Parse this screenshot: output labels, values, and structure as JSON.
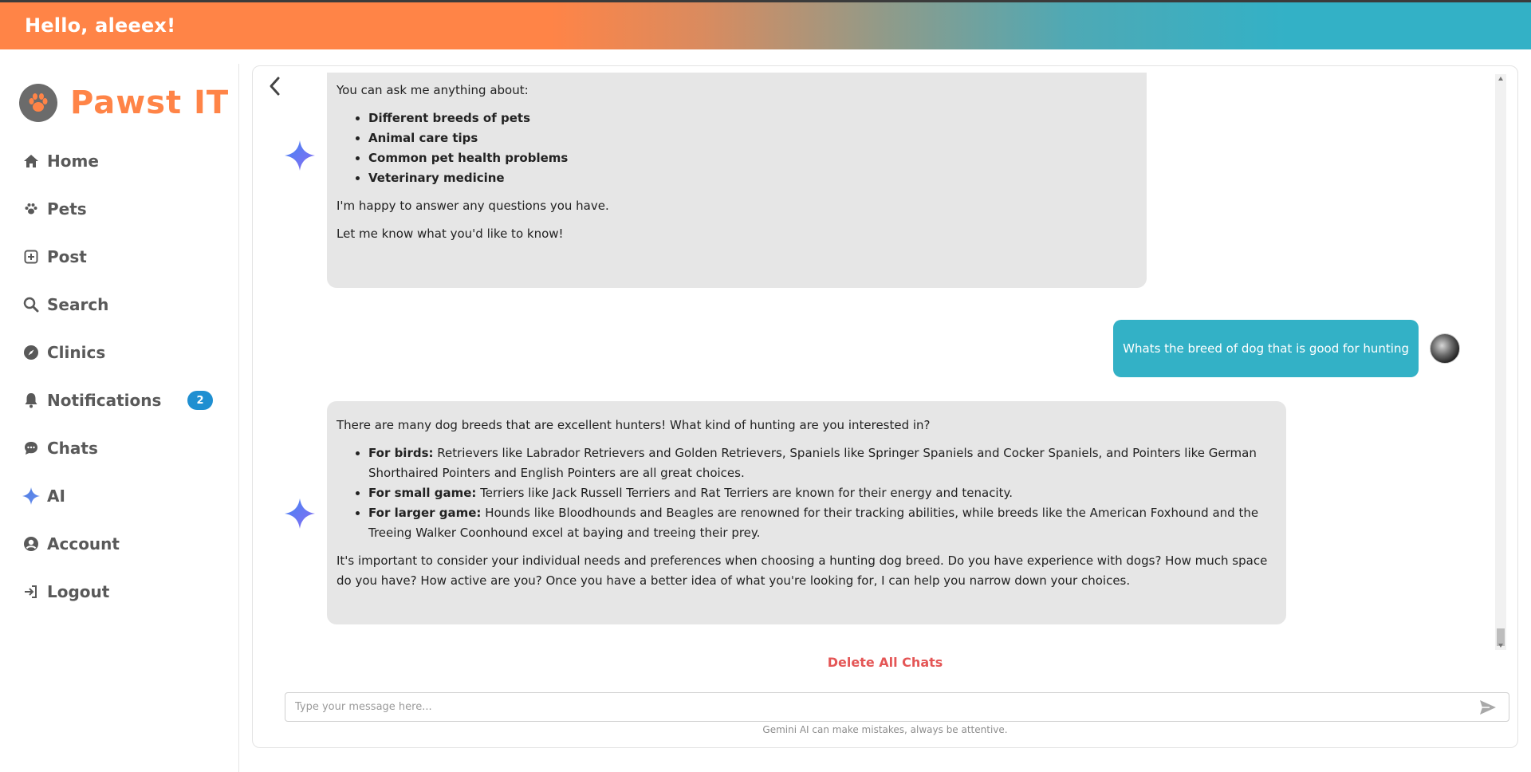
{
  "header": {
    "greeting": "Hello, aleeex!"
  },
  "brand": {
    "name": "Pawst IT",
    "color": "#ff8447"
  },
  "sidebar": {
    "items": [
      {
        "label": "Home",
        "icon": "home-icon"
      },
      {
        "label": "Pets",
        "icon": "paw-icon"
      },
      {
        "label": "Post",
        "icon": "plus-square-icon"
      },
      {
        "label": "Search",
        "icon": "search-icon"
      },
      {
        "label": "Clinics",
        "icon": "compass-icon"
      },
      {
        "label": "Notifications",
        "icon": "bell-icon",
        "badge": "2"
      },
      {
        "label": "Chats",
        "icon": "chat-icon"
      },
      {
        "label": "AI",
        "icon": "sparkle-icon"
      },
      {
        "label": "Account",
        "icon": "user-circle-icon"
      },
      {
        "label": "Logout",
        "icon": "logout-icon"
      }
    ]
  },
  "chat": {
    "messages": [
      {
        "role": "ai",
        "intro": "You can ask me anything about:",
        "bullets": [
          "Different breeds of pets",
          "Animal care tips",
          "Common pet health problems",
          "Veterinary medicine"
        ],
        "p1": "I'm happy to answer any questions you have.",
        "p2": "Let me know what you'd like to know!"
      },
      {
        "role": "user",
        "text": "Whats the breed of dog that is good for hunting"
      },
      {
        "role": "ai",
        "intro": "There are many dog breeds that are excellent hunters! What kind of hunting are you interested in?",
        "bullets": [
          {
            "label": "For birds:",
            "text": " Retrievers like Labrador Retrievers and Golden Retrievers, Spaniels like Springer Spaniels and Cocker Spaniels, and Pointers like German Shorthaired Pointers and English Pointers are all great choices."
          },
          {
            "label": "For small game:",
            "text": " Terriers like Jack Russell Terriers and Rat Terriers are known for their energy and tenacity."
          },
          {
            "label": "For larger game:",
            "text": " Hounds like Bloodhounds and Beagles are renowned for their tracking abilities, while breeds like the American Foxhound and the Treeing Walker Coonhound excel at baying and treeing their prey."
          }
        ],
        "outro": "It's important to consider your individual needs and preferences when choosing a hunting dog breed. Do you have experience with dogs? How much space do you have? How active are you? Once you have a better idea of what you're looking for, I can help you narrow down your choices."
      }
    ],
    "delete_all_label": "Delete All Chats",
    "input_placeholder": "Type your message here...",
    "disclaimer": "Gemini AI can make mistakes, always be attentive."
  },
  "colors": {
    "accent_orange": "#ff8447",
    "accent_teal": "#33b1c6",
    "badge_blue": "#1f8fd1",
    "danger": "#e45656"
  }
}
